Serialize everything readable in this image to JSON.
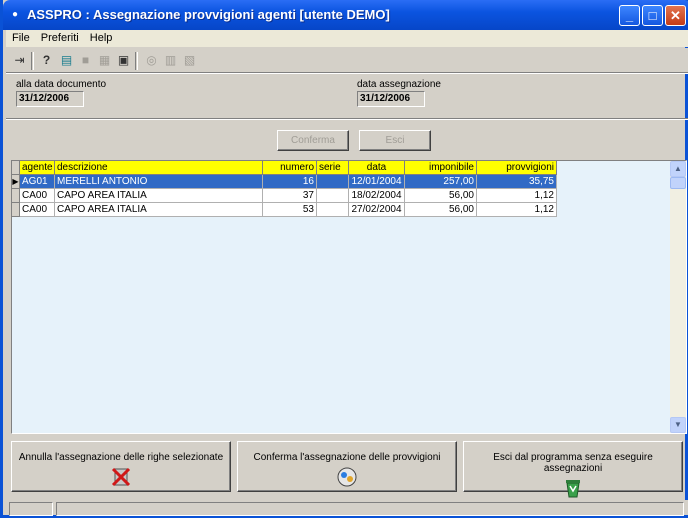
{
  "window": {
    "title": "ASSPRO : Assegnazione provvigioni agenti [utente DEMO]",
    "colors": {
      "titlebar": "#0b54e0",
      "grid_background": "#e6f2fa",
      "header_background": "#ffff00",
      "selected_row": "#316ac5"
    }
  },
  "menu": {
    "file": "File",
    "preferiti": "Preferiti",
    "help": "Help"
  },
  "toolbar": {
    "icons": [
      "exit-icon",
      "help-icon",
      "document-icon",
      "folder-icon",
      "print-preview-icon",
      "calculator-icon",
      "binoculars-icon",
      "trash-icon",
      "notes-icon"
    ]
  },
  "form": {
    "alla_data_documento_label": "alla data documento",
    "alla_data_documento_value": "31/12/2006",
    "data_assegnazione_label": "data assegnazione",
    "data_assegnazione_value": "31/12/2006"
  },
  "buttons": {
    "conferma": "Conferma",
    "esci": "Esci"
  },
  "grid": {
    "headers": [
      "agente",
      "descrizione",
      "numero",
      "serie",
      "data",
      "imponibile",
      "provvigioni"
    ],
    "rows": [
      [
        "AG01",
        "MERELLI ANTONIO",
        "16",
        "",
        "12/01/2004",
        "257,00",
        "35,75"
      ],
      [
        "CA00",
        "CAPO AREA ITALIA",
        "37",
        "",
        "18/02/2004",
        "56,00",
        "1,12"
      ],
      [
        "CA00",
        "CAPO AREA ITALIA",
        "53",
        "",
        "27/02/2004",
        "56,00",
        "1,12"
      ]
    ]
  },
  "actions": {
    "annulla": "Annulla l'assegnazione delle righe selezionate",
    "conferma": "Conferma l'assegnazione delle provvigioni",
    "esci": "Esci dal programma senza eseguire assegnazioni"
  }
}
